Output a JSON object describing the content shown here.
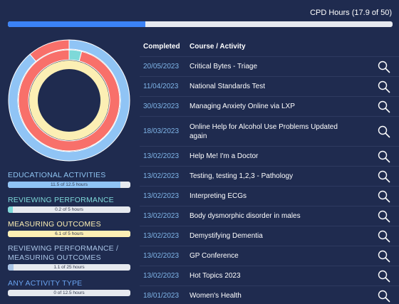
{
  "cpd": {
    "label": "CPD Hours (17.9 of 50)",
    "progress_fraction": 0.358,
    "fill_color": "#3b82f6"
  },
  "categories": [
    {
      "title": "EDUCATIONAL ACTIVITIES",
      "title_color": "#8ec3f0",
      "bar_text": "11.5 of 12.5 hours",
      "fraction": 0.92,
      "color": "#90c4f5"
    },
    {
      "title": "REVIEWING PERFORMANCE",
      "title_color": "#7ed9d9",
      "bar_text": "0.2 of 5 hours",
      "fraction": 0.04,
      "color": "#7ed9d9"
    },
    {
      "title": "MEASURING OUTCOMES",
      "title_color": "#fcefb4",
      "bar_text": "6.1 of 5 hours",
      "fraction": 1.0,
      "color": "#fcefb4"
    },
    {
      "title": "REVIEWING PERFORMANCE / MEASURING OUTCOMES",
      "title_color": "#a9c4e6",
      "bar_text": "1.1 of 25 hours",
      "fraction": 0.044,
      "color": "#a9c4e6"
    },
    {
      "title": "ANY ACTIVITY TYPE",
      "title_color": "#6aa3f0",
      "bar_text": "0 of 12.5 hours",
      "fraction": 0.0,
      "color": "#6aa3f0"
    }
  ],
  "table": {
    "headers": {
      "completed": "Completed",
      "course": "Course / Activity"
    },
    "rows": [
      {
        "date": "20/05/2023",
        "course": "Critical Bytes - Triage"
      },
      {
        "date": "11/04/2023",
        "course": "National Standards Test"
      },
      {
        "date": "30/03/2023",
        "course": "Managing Anxiety Online via LXP"
      },
      {
        "date": "18/03/2023",
        "course": "Online Help for Alcohol Use Problems Updated again",
        "tall": true
      },
      {
        "date": "13/02/2023",
        "course": "Help Me! I'm a Doctor"
      },
      {
        "date": "13/02/2023",
        "course": "Testing, testing 1,2,3 - Pathology"
      },
      {
        "date": "13/02/2023",
        "course": "Interpreting ECGs"
      },
      {
        "date": "13/02/2023",
        "course": "Body dysmorphic disorder in males"
      },
      {
        "date": "13/02/2023",
        "course": "Demystifying Dementia"
      },
      {
        "date": "13/02/2023",
        "course": "GP Conference"
      },
      {
        "date": "13/02/2023",
        "course": "Hot Topics 2023"
      },
      {
        "date": "18/01/2023",
        "course": "Women's Health"
      }
    ],
    "action_icon": "search-icon"
  },
  "donut": {
    "outer_ring": [
      {
        "category": "EDUCATIONAL ACTIVITIES",
        "fraction": 0.888,
        "color": "#90c4f5"
      },
      {
        "category": "REVIEWING PERFORMANCE",
        "fraction": 0.0,
        "color": "#7ed9d9"
      },
      {
        "category": "MEASURING OUTCOMES",
        "fraction": 0.112,
        "color": "#f8706a"
      }
    ],
    "middle_ring": [
      {
        "fraction": 0.04,
        "color": "#7ed9d9"
      },
      {
        "fraction": 0.96,
        "color": "#f8706a"
      }
    ],
    "inner_ring": [
      {
        "fraction": 1.0,
        "color": "#fcefb4"
      }
    ],
    "center_color": "#1f2b4f"
  }
}
